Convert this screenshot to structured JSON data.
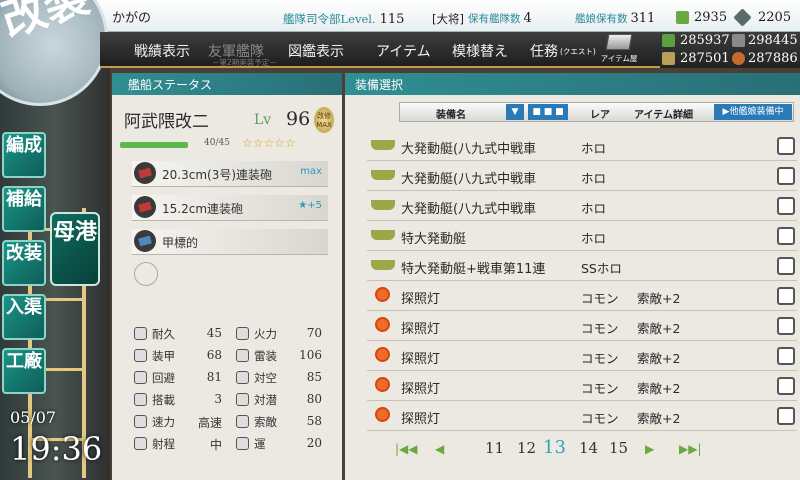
{
  "topbar": {
    "admiral_name": "かがの",
    "hq_label": "艦隊司令部Level.",
    "hq_level": "115",
    "rank": "[大将]",
    "ship_count_label": "保有艦隊数",
    "ship_count": "4",
    "equip_count_label": "艦娘保有数",
    "equip_count": "311",
    "bucket": "2935",
    "devmat": "2205"
  },
  "resources": {
    "fuel": "285937",
    "ammo": "298445",
    "steel": "287501",
    "bauxite": "287886"
  },
  "menu": {
    "items": [
      "戦績表示",
      "友軍艦隊",
      "図鑑表示",
      "アイテム",
      "模様替え",
      "任務"
    ],
    "friend_sub": "－第2期実装予定－",
    "quest_sub": "(クエスト)",
    "item_shop": "アイテム屋"
  },
  "logo": {
    "glyph": "改装"
  },
  "nav": {
    "items": [
      "編成",
      "補給",
      "改装",
      "入渠",
      "工廠"
    ],
    "port": "母港",
    "date": "05/07",
    "time": "19:36"
  },
  "ship": {
    "header": "艦船ステータス",
    "name": "阿武隈改二",
    "lv_label": "Lv",
    "lv": "96",
    "remodel": "改修MAX",
    "hp": "40/45",
    "hp_ratio": 0.89,
    "stars": "☆☆☆☆☆",
    "slots": [
      {
        "name": "20.3cm(3号)連装砲",
        "extra": "max"
      },
      {
        "name": "15.2cm連装砲",
        "extra": "★+5"
      },
      {
        "name": "甲標的",
        "extra": ""
      }
    ],
    "stats_left": [
      {
        "label": "耐久",
        "value": "45"
      },
      {
        "label": "装甲",
        "value": "68"
      },
      {
        "label": "回避",
        "value": "81"
      },
      {
        "label": "搭載",
        "value": "3"
      },
      {
        "label": "速力",
        "value": "高速"
      },
      {
        "label": "射程",
        "value": "中"
      }
    ],
    "stats_right": [
      {
        "label": "火力",
        "value": "70"
      },
      {
        "label": "雷装",
        "value": "106"
      },
      {
        "label": "対空",
        "value": "85"
      },
      {
        "label": "対潜",
        "value": "80"
      },
      {
        "label": "索敵",
        "value": "58"
      },
      {
        "label": "運",
        "value": "20"
      }
    ]
  },
  "equip": {
    "header": "装備選択",
    "col_name": "装備名",
    "col_dots": "■ ■ ■",
    "col_rare": "レア",
    "col_detail": "アイテム詳細",
    "other_btn": "▶他艦娘装備中",
    "rows": [
      {
        "name": "大発動艇(八九式中戦車",
        "rare": "ホロ",
        "detail": "",
        "icon": "landing"
      },
      {
        "name": "大発動艇(八九式中戦車",
        "rare": "ホロ",
        "detail": "",
        "icon": "landing"
      },
      {
        "name": "大発動艇(八九式中戦車",
        "rare": "ホロ",
        "detail": "",
        "icon": "landing"
      },
      {
        "name": "特大発動艇",
        "rare": "ホロ",
        "detail": "",
        "icon": "landing"
      },
      {
        "name": "特大発動艇+戦車第11連",
        "rare": "SSホロ",
        "detail": "",
        "icon": "landing"
      },
      {
        "name": "探照灯",
        "rare": "コモン",
        "detail": "索敵+2",
        "icon": "searchlight"
      },
      {
        "name": "探照灯",
        "rare": "コモン",
        "detail": "索敵+2",
        "icon": "searchlight"
      },
      {
        "name": "探照灯",
        "rare": "コモン",
        "detail": "索敵+2",
        "icon": "searchlight"
      },
      {
        "name": "探照灯",
        "rare": "コモン",
        "detail": "索敵+2",
        "icon": "searchlight"
      },
      {
        "name": "探照灯",
        "rare": "コモン",
        "detail": "索敵+2",
        "icon": "searchlight"
      }
    ],
    "pages": [
      "11",
      "12",
      "13",
      "14",
      "15"
    ],
    "current_page": "13"
  }
}
